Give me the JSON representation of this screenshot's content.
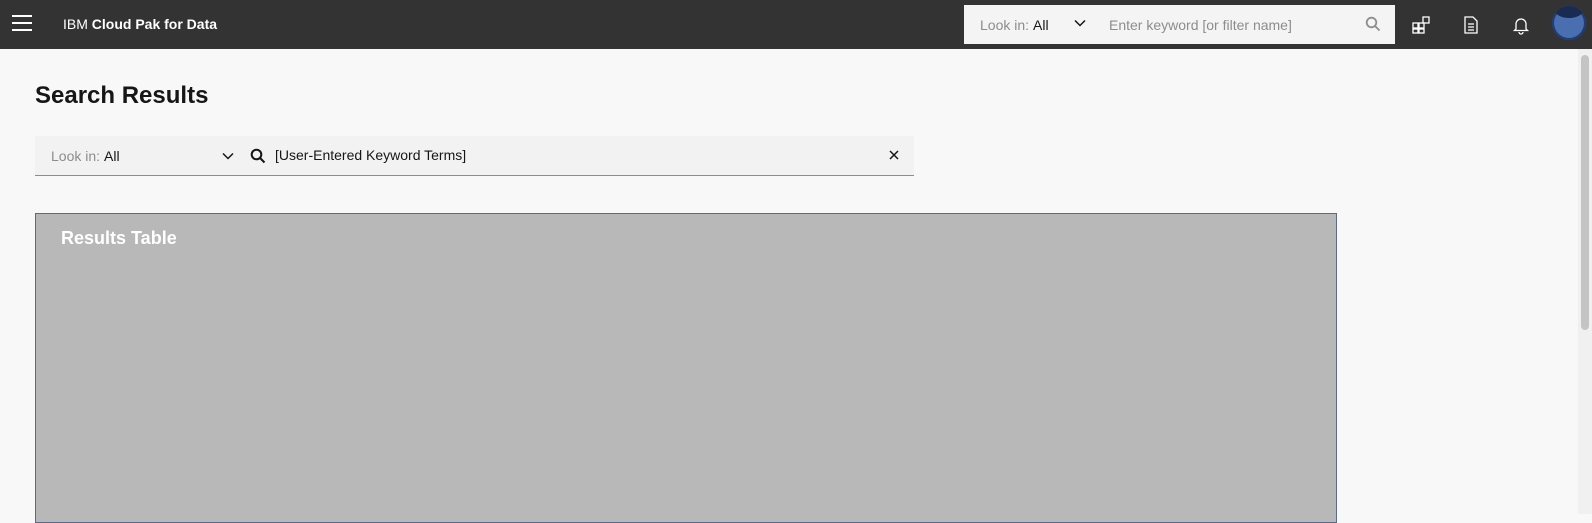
{
  "header": {
    "brand_prefix": "IBM",
    "brand_name": "Cloud Pak for Data",
    "search": {
      "lookin_label": "Look in:",
      "lookin_value": "All",
      "placeholder": "Enter keyword [or filter name]"
    },
    "icons": [
      "menu-icon",
      "apps-icon",
      "document-icon",
      "notification-icon",
      "avatar"
    ]
  },
  "page": {
    "title": "Search Results",
    "search": {
      "lookin_label": "Look in:",
      "lookin_value": "All",
      "value": "[User-Entered Keyword Terms]"
    },
    "results_label": "Results Table"
  },
  "colors": {
    "header_bg": "#333333",
    "page_bg": "#f8f8f8",
    "results_bg": "#b8b8b8",
    "avatar": "#4a6fb0"
  }
}
